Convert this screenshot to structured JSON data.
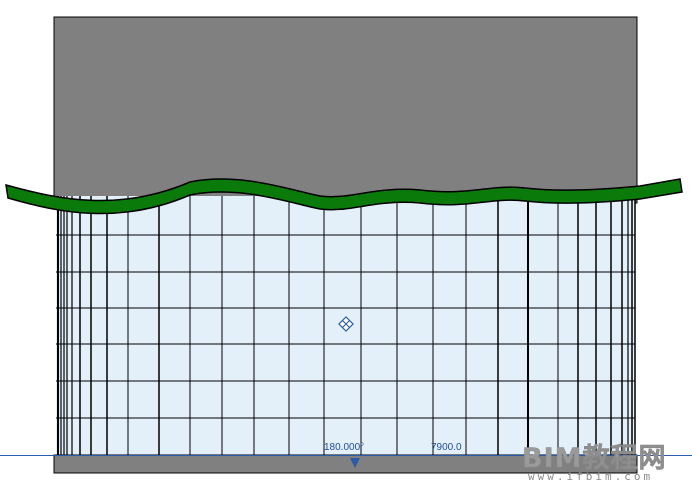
{
  "annotations": {
    "angle_label": "180.000°",
    "length_label": "7900.0"
  },
  "watermark": {
    "logo_text": "BIM教程网",
    "url": "www.ifbim.com"
  },
  "colors": {
    "wall_gray": "#808080",
    "glass": "#e3f0fa",
    "mullion": "#000000",
    "green_sweep": "#0a7a0a",
    "selection_blue": "#2a5aa8"
  },
  "icons": [
    "flip-control-icon",
    "drag-arrow-icon"
  ]
}
